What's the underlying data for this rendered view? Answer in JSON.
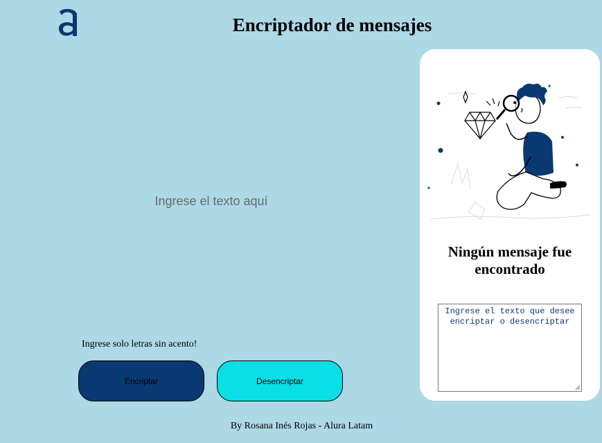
{
  "header": {
    "logo_icon": "alura-logo-icon",
    "title": "Encriptador de mensajes"
  },
  "main": {
    "input_placeholder": "Ingrese el texto aquí",
    "hint": "Ingrese solo letras sin acento!",
    "encrypt_label": "Encriptar",
    "decrypt_label": "Desencriptar"
  },
  "panel": {
    "illustration_icon": "boy-with-magnifying-glass-icon",
    "title": "Ningún mensaje fue encontrado",
    "output_placeholder": "Ingrese el texto que desee encriptar o desencriptar"
  },
  "footer": {
    "text": "By Rosana Inés Rojas - Alura Latam"
  },
  "colors": {
    "background": "#add8e6",
    "primary": "#0a3871",
    "accent": "#0adfe8",
    "panel": "#ffffff"
  }
}
